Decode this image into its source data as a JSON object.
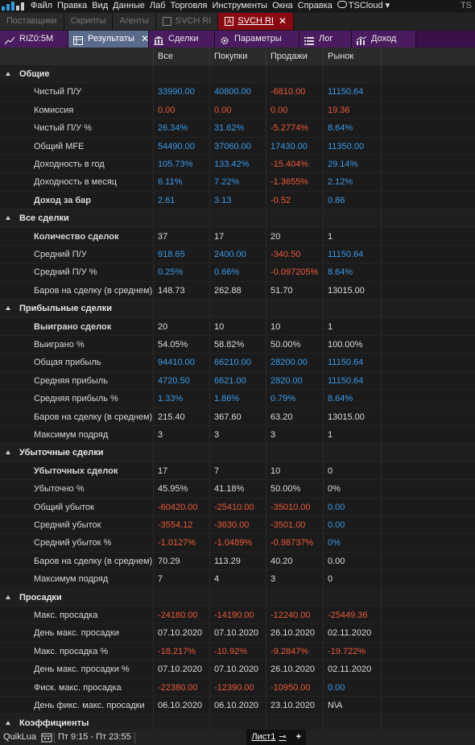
{
  "menubar": {
    "items": [
      "Файл",
      "Правка",
      "Вид",
      "Данные",
      "Лаб",
      "Торговля",
      "Инструменты",
      "Окна",
      "Справка"
    ],
    "cloud": "TSCloud ▾",
    "right": "TS"
  },
  "doc_tabs": [
    {
      "label": "Поставщики",
      "active": false
    },
    {
      "label": "Скрипты",
      "active": false
    },
    {
      "label": "Агенты",
      "active": false
    },
    {
      "label": "SVCH RI",
      "active": false
    },
    {
      "label": "SVCH RI",
      "active": true
    }
  ],
  "inner_tabs": [
    {
      "label": "RIZ0:5M",
      "icon": "chart-icon"
    },
    {
      "label": "Результаты",
      "icon": "table-icon",
      "active": true
    },
    {
      "label": "Сделки",
      "icon": "bank-icon"
    },
    {
      "label": "Параметры",
      "icon": "gear-icon"
    },
    {
      "label": "Лог",
      "icon": "list-icon"
    },
    {
      "label": "Доход",
      "icon": "chart-bars-icon"
    }
  ],
  "columns": [
    "Все",
    "Покупки",
    "Продажи",
    "Рынок"
  ],
  "colors": {
    "blue": "#3a9ae8",
    "red": "#ec5a3a",
    "white": "#dcdcdc"
  },
  "rows": [
    {
      "section": "Общие"
    },
    {
      "label": "Чистый П/У",
      "v": [
        [
          "33990.00",
          "b"
        ],
        [
          "40800.00",
          "b"
        ],
        [
          "-6810.00",
          "r"
        ],
        [
          "11150.64",
          "b"
        ]
      ]
    },
    {
      "label": "Комиссия",
      "v": [
        [
          "0.00",
          "r"
        ],
        [
          "0.00",
          "r"
        ],
        [
          "0.00",
          "r"
        ],
        [
          "19.36",
          "r"
        ]
      ]
    },
    {
      "label": "Чистый П/У %",
      "v": [
        [
          "26.34%",
          "b"
        ],
        [
          "31.62%",
          "b"
        ],
        [
          "-5.2774%",
          "r"
        ],
        [
          "8.64%",
          "b"
        ]
      ]
    },
    {
      "label": "Общий MFE",
      "v": [
        [
          "54490.00",
          "b"
        ],
        [
          "37060.00",
          "b"
        ],
        [
          "17430.00",
          "b"
        ],
        [
          "11350.00",
          "b"
        ]
      ]
    },
    {
      "label": "Доходность в год",
      "v": [
        [
          "105.73%",
          "b"
        ],
        [
          "133.42%",
          "b"
        ],
        [
          "-15.404%",
          "r"
        ],
        [
          "29.14%",
          "b"
        ]
      ]
    },
    {
      "label": "Доходность в месяц",
      "v": [
        [
          "6.11%",
          "b"
        ],
        [
          "7.22%",
          "b"
        ],
        [
          "-1.3655%",
          "r"
        ],
        [
          "2.12%",
          "b"
        ]
      ]
    },
    {
      "label": "Доход за бар",
      "bold": true,
      "v": [
        [
          "2.61",
          "b"
        ],
        [
          "3.13",
          "b"
        ],
        [
          "-0.52",
          "r"
        ],
        [
          "0.86",
          "b"
        ]
      ]
    },
    {
      "section": "Все сделки"
    },
    {
      "label": "Количество сделок",
      "bold": true,
      "v": [
        [
          "37",
          "w"
        ],
        [
          "17",
          "w"
        ],
        [
          "20",
          "w"
        ],
        [
          "1",
          "w"
        ]
      ]
    },
    {
      "label": "Средний П/У",
      "v": [
        [
          "918.65",
          "b"
        ],
        [
          "2400.00",
          "b"
        ],
        [
          "-340.50",
          "r"
        ],
        [
          "11150.64",
          "b"
        ]
      ]
    },
    {
      "label": "Средний П/У %",
      "v": [
        [
          "0.25%",
          "b"
        ],
        [
          "0.66%",
          "b"
        ],
        [
          "-0.097205%",
          "r"
        ],
        [
          "8.64%",
          "b"
        ]
      ]
    },
    {
      "label": "Баров на сделку (в среднем)",
      "v": [
        [
          "148.73",
          "w"
        ],
        [
          "262.88",
          "w"
        ],
        [
          "51.70",
          "w"
        ],
        [
          "13015.00",
          "w"
        ]
      ]
    },
    {
      "section": "Прибыльные сделки"
    },
    {
      "label": "Выиграно сделок",
      "bold": true,
      "v": [
        [
          "20",
          "w"
        ],
        [
          "10",
          "w"
        ],
        [
          "10",
          "w"
        ],
        [
          "1",
          "w"
        ]
      ]
    },
    {
      "label": "Выиграно %",
      "v": [
        [
          "54.05%",
          "w"
        ],
        [
          "58.82%",
          "w"
        ],
        [
          "50.00%",
          "w"
        ],
        [
          "100.00%",
          "w"
        ]
      ]
    },
    {
      "label": "Общая прибыль",
      "v": [
        [
          "94410.00",
          "b"
        ],
        [
          "66210.00",
          "b"
        ],
        [
          "28200.00",
          "b"
        ],
        [
          "11150.64",
          "b"
        ]
      ]
    },
    {
      "label": "Средняя прибыль",
      "v": [
        [
          "4720.50",
          "b"
        ],
        [
          "6621.00",
          "b"
        ],
        [
          "2820.00",
          "b"
        ],
        [
          "11150.64",
          "b"
        ]
      ]
    },
    {
      "label": "Средняя прибыль %",
      "v": [
        [
          "1.33%",
          "b"
        ],
        [
          "1.86%",
          "b"
        ],
        [
          "0.79%",
          "b"
        ],
        [
          "8.64%",
          "b"
        ]
      ]
    },
    {
      "label": "Баров на сделку (в среднем)",
      "v": [
        [
          "215.40",
          "w"
        ],
        [
          "367.60",
          "w"
        ],
        [
          "63.20",
          "w"
        ],
        [
          "13015.00",
          "w"
        ]
      ]
    },
    {
      "label": "Максимум подряд",
      "v": [
        [
          "3",
          "w"
        ],
        [
          "3",
          "w"
        ],
        [
          "3",
          "w"
        ],
        [
          "1",
          "w"
        ]
      ]
    },
    {
      "section": "Убыточные сделки"
    },
    {
      "label": "Убыточных сделок",
      "bold": true,
      "v": [
        [
          "17",
          "w"
        ],
        [
          "7",
          "w"
        ],
        [
          "10",
          "w"
        ],
        [
          "0",
          "w"
        ]
      ]
    },
    {
      "label": "Убыточно %",
      "v": [
        [
          "45.95%",
          "w"
        ],
        [
          "41.18%",
          "w"
        ],
        [
          "50.00%",
          "w"
        ],
        [
          "0%",
          "w"
        ]
      ]
    },
    {
      "label": "Общий убыток",
      "v": [
        [
          "-60420.00",
          "r"
        ],
        [
          "-25410.00",
          "r"
        ],
        [
          "-35010.00",
          "r"
        ],
        [
          "0.00",
          "b"
        ]
      ]
    },
    {
      "label": "Средний убыток",
      "v": [
        [
          "-3554.12",
          "r"
        ],
        [
          "-3630.00",
          "r"
        ],
        [
          "-3501.00",
          "r"
        ],
        [
          "0.00",
          "b"
        ]
      ]
    },
    {
      "label": "Средний убыток %",
      "v": [
        [
          "-1.0127%",
          "r"
        ],
        [
          "-1.0489%",
          "r"
        ],
        [
          "-0.98737%",
          "r"
        ],
        [
          "0%",
          "b"
        ]
      ]
    },
    {
      "label": "Баров на сделку (в среднем)",
      "v": [
        [
          "70.29",
          "w"
        ],
        [
          "113.29",
          "w"
        ],
        [
          "40.20",
          "w"
        ],
        [
          "0.00",
          "w"
        ]
      ]
    },
    {
      "label": "Максимум подряд",
      "v": [
        [
          "7",
          "w"
        ],
        [
          "4",
          "w"
        ],
        [
          "3",
          "w"
        ],
        [
          "0",
          "w"
        ]
      ]
    },
    {
      "section": "Просадки"
    },
    {
      "label": "Макс. просадка",
      "v": [
        [
          "-24180.00",
          "r"
        ],
        [
          "-14190.00",
          "r"
        ],
        [
          "-12240.00",
          "r"
        ],
        [
          "-25449.36",
          "r"
        ]
      ]
    },
    {
      "label": "День макс. просадки",
      "v": [
        [
          "07.10.2020",
          "w"
        ],
        [
          "07.10.2020",
          "w"
        ],
        [
          "26.10.2020",
          "w"
        ],
        [
          "02.11.2020",
          "w"
        ]
      ]
    },
    {
      "label": "Макс. просадка %",
      "v": [
        [
          "-18.217%",
          "r"
        ],
        [
          "-10.92%",
          "r"
        ],
        [
          "-9.2847%",
          "r"
        ],
        [
          "-19.722%",
          "r"
        ]
      ]
    },
    {
      "label": "День макс. просадки %",
      "v": [
        [
          "07.10.2020",
          "w"
        ],
        [
          "07.10.2020",
          "w"
        ],
        [
          "26.10.2020",
          "w"
        ],
        [
          "02.11.2020",
          "w"
        ]
      ]
    },
    {
      "label": "Фиск. макс. просадка",
      "v": [
        [
          "-22380.00",
          "r"
        ],
        [
          "-12390.00",
          "r"
        ],
        [
          "-10950.00",
          "r"
        ],
        [
          "0.00",
          "b"
        ]
      ]
    },
    {
      "label": "День фикс. макс. просадки",
      "v": [
        [
          "06.10.2020",
          "w"
        ],
        [
          "06.10.2020",
          "w"
        ],
        [
          "23.10.2020",
          "w"
        ],
        [
          "N\\A",
          "w"
        ]
      ]
    },
    {
      "section": "Коэффициенты"
    }
  ],
  "statusbar": {
    "app": "QuikLua",
    "session": "Пт 9:15 - Пт 23:55",
    "sheet": "Лист1",
    "add": "+"
  }
}
